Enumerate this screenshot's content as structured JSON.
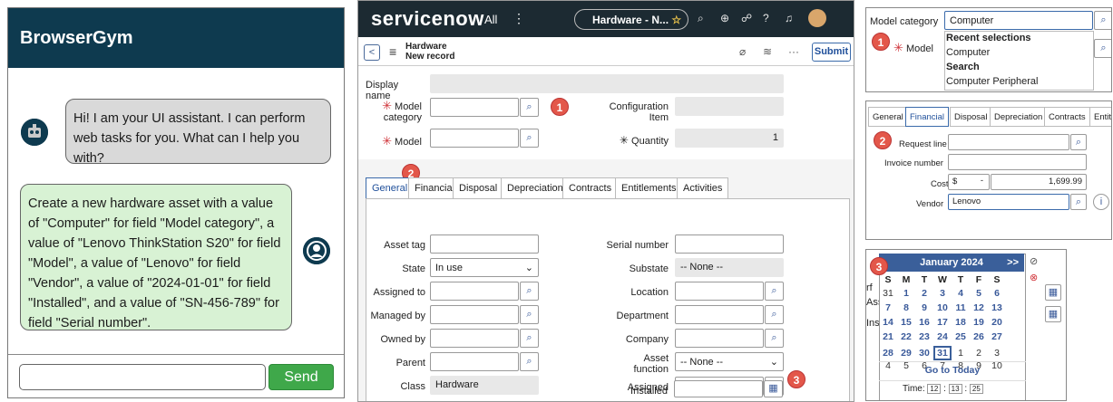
{
  "browsergym": {
    "title": "BrowserGym",
    "assistant_msg": "Hi! I am your UI assistant. I can perform web tasks for you. What can I help you with?",
    "user_msg": "Create a new hardware asset with a value of \"Computer\" for field \"Model category\", a value of \"Lenovo ThinkStation S20\" for field \"Model\", a value of \"Lenovo\" for field \"Vendor\", a value of \"2024-01-01\" for field \"Installed\", and a value of \"SN-456-789\" for field \"Serial number\".",
    "input_value": "",
    "send_label": "Send"
  },
  "servicenow": {
    "logo": "servicenow",
    "nav_all": "All",
    "nav_dots": "⋮",
    "pill_label": "Hardware - N...",
    "record_title_1": "Hardware",
    "record_title_2": "New record",
    "submit_label": "Submit",
    "fields": {
      "display_name": "Display name",
      "model_category": "Model category",
      "model": "Model",
      "configuration_item": "Configuration Item",
      "quantity": "Quantity",
      "quantity_value": "1"
    },
    "tabs": [
      "General",
      "Financial",
      "Disposal",
      "Depreciation",
      "Contracts",
      "Entitlements",
      "Activities"
    ],
    "general": {
      "asset_tag": "Asset tag",
      "state": "State",
      "state_value": "In use",
      "assigned_to": "Assigned to",
      "managed_by": "Managed by",
      "owned_by": "Owned by",
      "parent": "Parent",
      "class": "Class",
      "class_value": "Hardware",
      "serial_number": "Serial number",
      "substate": "Substate",
      "substate_value": "-- None --",
      "location": "Location",
      "department": "Department",
      "company": "Company",
      "asset_function": "Asset function",
      "asset_function_value": "-- None --",
      "assigned": "Assigned",
      "installed": "Installed"
    },
    "badges": [
      "1",
      "2",
      "3"
    ]
  },
  "crop_model": {
    "label": "Model category",
    "value": "Computer",
    "model_label": "Model",
    "recent_header": "Recent selections",
    "recent_item": "Computer",
    "search_header": "Search",
    "search_item": "Computer Peripheral"
  },
  "crop_financial": {
    "tabs": [
      "General",
      "Financial",
      "Disposal",
      "Depreciation",
      "Contracts",
      "Entitl"
    ],
    "request_line": "Request line",
    "invoice_number": "Invoice number",
    "cost": "Cost",
    "cost_currency": "$",
    "cost_value": "1,699.99",
    "vendor": "Vendor",
    "vendor_value": "Lenovo"
  },
  "crop_calendar": {
    "month": "January 2024",
    "next": ">>",
    "days_header": [
      "S",
      "M",
      "T",
      "W",
      "T",
      "F",
      "S"
    ],
    "weeks": [
      [
        "31",
        "1",
        "2",
        "3",
        "4",
        "5",
        "6"
      ],
      [
        "7",
        "8",
        "9",
        "10",
        "11",
        "12",
        "13"
      ],
      [
        "14",
        "15",
        "16",
        "17",
        "18",
        "19",
        "20"
      ],
      [
        "21",
        "22",
        "23",
        "24",
        "25",
        "26",
        "27"
      ],
      [
        "28",
        "29",
        "30",
        "31",
        "1",
        "2",
        "3"
      ],
      [
        "4",
        "5",
        "6",
        "7",
        "8",
        "9",
        "10"
      ]
    ],
    "go_today": "Go to Today",
    "time_label": "Time:",
    "time_h": "12",
    "time_m": "13",
    "time_s": "25",
    "side_labels": [
      "rf",
      "Ass",
      "Ins"
    ]
  },
  "colors": {
    "header": "#0e3a4f",
    "send": "#3fa84a",
    "badge": "#e3574a",
    "sn_dark": "#1c2a32"
  }
}
